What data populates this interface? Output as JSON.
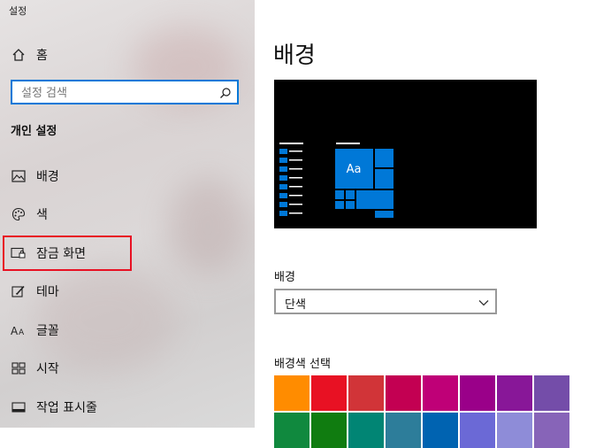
{
  "window": {
    "title": "설정"
  },
  "sidebar": {
    "home_label": "홈",
    "search_placeholder": "설정 검색",
    "section_heading": "개인 설정",
    "items": [
      {
        "label": "배경",
        "icon": "image-icon"
      },
      {
        "label": "색",
        "icon": "palette-icon"
      },
      {
        "label": "잠금 화면",
        "icon": "lock-screen-icon"
      },
      {
        "label": "테마",
        "icon": "brush-icon"
      },
      {
        "label": "글꼴",
        "icon": "font-icon"
      },
      {
        "label": "시작",
        "icon": "start-grid-icon"
      },
      {
        "label": "작업 표시줄",
        "icon": "taskbar-icon"
      }
    ]
  },
  "main": {
    "title": "배경",
    "preview_tile_text": "Aa",
    "background_label": "배경",
    "background_value": "단색",
    "color_label": "배경색 선택",
    "swatches": [
      "#ff8c00",
      "#e81123",
      "#d13438",
      "#c30052",
      "#bf0077",
      "#9a0089",
      "#881798",
      "#744da9",
      "#10893e",
      "#107c10",
      "#018574",
      "#2d7d9a",
      "#0063b1",
      "#6b69d6",
      "#8e8cd8",
      "#8764b8"
    ]
  },
  "colors": {
    "accent": "#0078d7",
    "highlight_box": "#e81123"
  }
}
